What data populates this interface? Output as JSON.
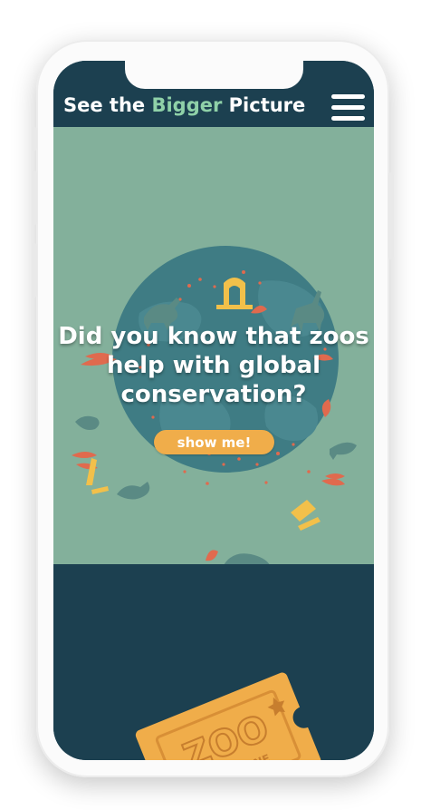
{
  "header": {
    "brand_part1": "See the",
    "brand_accent": "Bigger",
    "brand_part2": "Picture",
    "menu_icon": "hamburger-menu-icon"
  },
  "hero": {
    "title": "Did you know that zoos help with global conservation?",
    "cta_label": "show me!"
  },
  "ticket": {
    "title": "ZOO",
    "subtitle": "ADMIT ONE"
  },
  "colors": {
    "header_bg": "#1c4050",
    "hero_bg": "#83b09b",
    "brand_accent": "#8fd1a8",
    "globe": "#3f7c84",
    "cta": "#f0ad4a",
    "ticket": "#f0ad4a"
  }
}
